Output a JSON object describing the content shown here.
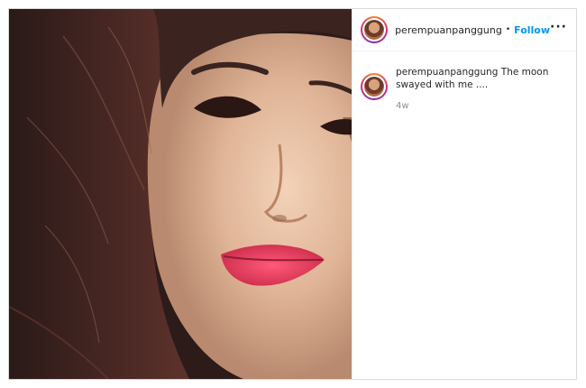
{
  "post": {
    "photo_alt": "selfie",
    "header": {
      "username": "perempuanpanggung",
      "separator": "•",
      "follow_label": "Follow",
      "more_label": "···"
    },
    "caption": {
      "username": "perempuanpanggung",
      "text": "The moon swayed with me ....",
      "timestamp": "4w"
    }
  },
  "colors": {
    "follow": "#0095f6",
    "border": "#dbdbdb",
    "muted": "#8e8e8e"
  },
  "icons": [
    "more-options-icon",
    "avatar-ring"
  ]
}
